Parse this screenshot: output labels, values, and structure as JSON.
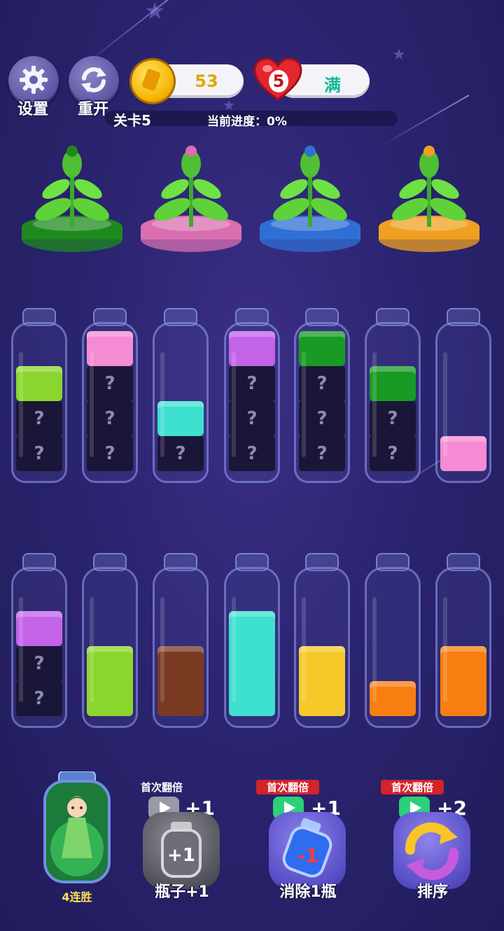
{
  "top_bar": {
    "settings_label": "设置",
    "restart_label": "重开",
    "coins": "53",
    "lives": "5",
    "lives_status": "满"
  },
  "progress": {
    "level": "关卡5",
    "progress_text": "当前进度：0%"
  },
  "pedestals": [
    {
      "color": "#1e8a1e"
    },
    {
      "color": "#d96fb0"
    },
    {
      "color": "#2f6fd4"
    },
    {
      "color": "#f0a020"
    }
  ],
  "bottles_row1": [
    {
      "layers": [
        {
          "color": "#8bd62e",
          "level": 1
        }
      ],
      "hidden": 2
    },
    {
      "layers": [
        {
          "color": "#f58bd3",
          "level": 1
        }
      ],
      "hidden": 3
    },
    {
      "layers": [
        {
          "color": "#3ee0cf",
          "level": 1
        }
      ],
      "hidden": 1
    },
    {
      "layers": [
        {
          "color": "#c263e8",
          "level": 1
        }
      ],
      "hidden": 3
    },
    {
      "layers": [
        {
          "color": "#199a24",
          "level": 1
        }
      ],
      "hidden": 3
    },
    {
      "layers": [
        {
          "color": "#199a24",
          "level": 1
        }
      ],
      "hidden": 2
    },
    {
      "layers": [
        {
          "color": "#f58bd3",
          "level": 1
        }
      ],
      "hidden": 0
    }
  ],
  "bottles_row2": [
    {
      "layers": [
        {
          "color": "#c263e8",
          "level": 1
        }
      ],
      "hidden": 2
    },
    {
      "layers": [
        {
          "color": "#8bd62e",
          "level": 2
        }
      ],
      "hidden": 0
    },
    {
      "layers": [
        {
          "color": "#7a3a22",
          "level": 2
        }
      ],
      "hidden": 0
    },
    {
      "layers": [
        {
          "color": "#3ee0cf",
          "level": 3
        }
      ],
      "hidden": 0
    },
    {
      "layers": [
        {
          "color": "#f6c92a",
          "level": 2
        }
      ],
      "hidden": 0
    },
    {
      "layers": [
        {
          "color": "#f77f12",
          "level": 1
        }
      ],
      "hidden": 0
    },
    {
      "layers": [
        {
          "color": "#f77f12",
          "level": 2
        }
      ],
      "hidden": 0
    }
  ],
  "boosters": {
    "streak_label": "4连胜",
    "add_bottle": {
      "tag": "首次翻倍",
      "plus": "+1",
      "label": "瓶子+1",
      "icon_text": "+1"
    },
    "remove_bottle": {
      "tag": "首次翻倍",
      "plus": "+1",
      "label": "消除1瓶",
      "icon_text": "-1"
    },
    "sort": {
      "tag": "首次翻倍",
      "plus": "+2",
      "label": "排序"
    }
  }
}
